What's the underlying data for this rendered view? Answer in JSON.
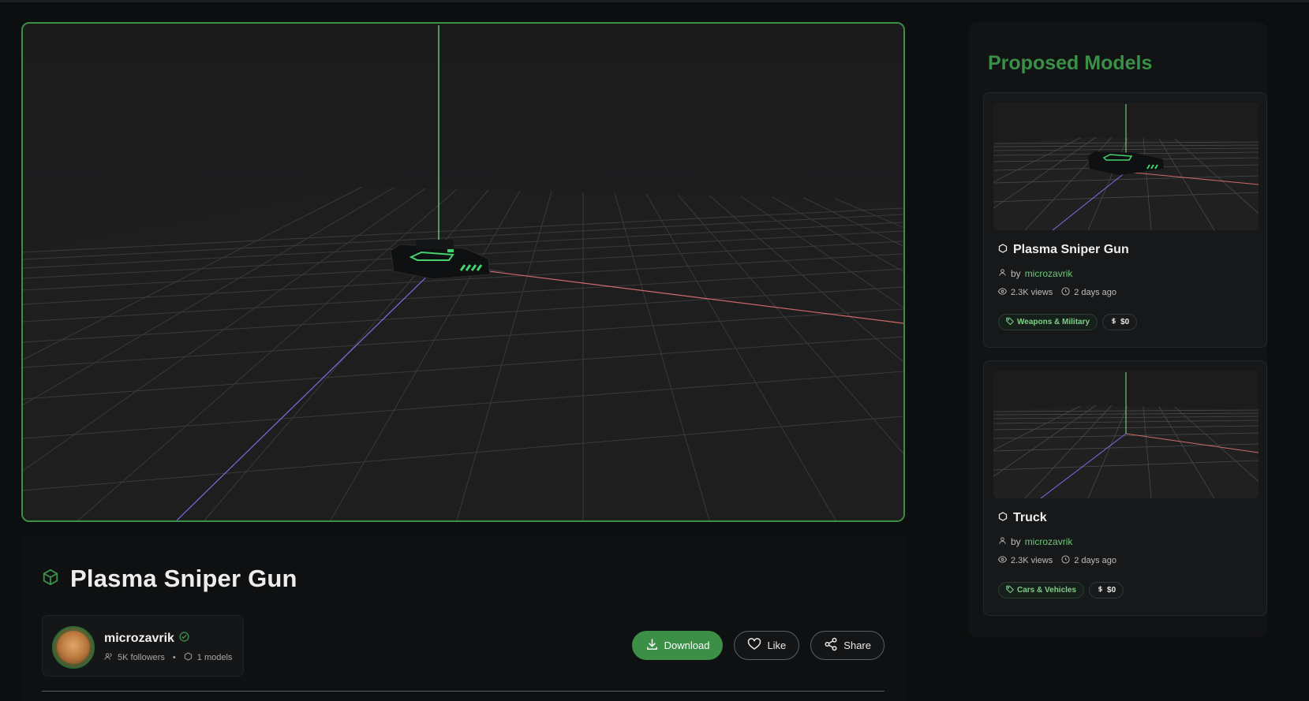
{
  "model": {
    "title": "Plasma Sniper Gun"
  },
  "author": {
    "name": "microzavrik",
    "followers": "5K followers",
    "separator": "•",
    "models": "1 models"
  },
  "actions": {
    "download": "Download",
    "like": "Like",
    "share": "Share"
  },
  "sidebar": {
    "title": "Proposed Models",
    "cards": [
      {
        "name": "Plasma Sniper Gun",
        "by": "by",
        "author": "microzavrik",
        "views": "2.3K views",
        "time": "2 days ago",
        "category": "Weapons & Military",
        "price": "$0"
      },
      {
        "name": "Truck",
        "by": "by",
        "author": "microzavrik",
        "views": "2.3K views",
        "time": "2 days ago",
        "category": "Cars & Vehicles",
        "price": "$0"
      }
    ]
  },
  "icons": {
    "title": "cube-icon",
    "verified": "check-circle-icon",
    "followers": "users-icon",
    "models": "hexagon-icon",
    "download": "download-icon",
    "like": "heart-icon",
    "share": "share-icon",
    "author": "user-icon",
    "views": "eye-icon",
    "time": "clock-icon",
    "tag": "tag-icon",
    "price": "dollar-icon"
  },
  "colors": {
    "accent": "#3b8f46",
    "accent_text": "#6fc87a",
    "axis_x": "#d16a6a",
    "axis_y": "#7ee38a",
    "axis_z": "#7a6ee6",
    "background": "#0d0e0f"
  }
}
